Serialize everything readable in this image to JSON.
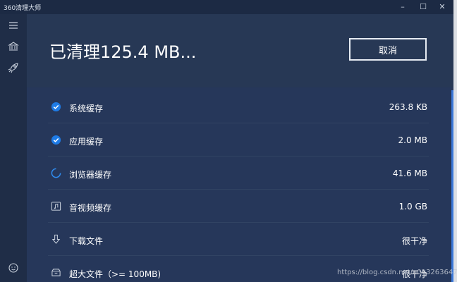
{
  "window": {
    "title": "360清理大师"
  },
  "titlebar": {
    "minimize_glyph": "–",
    "maximize_glyph": "☐",
    "close_glyph": "✕"
  },
  "sidebar": {
    "icons": [
      "menu-icon",
      "bank-icon",
      "rocket-icon",
      "smiley-icon"
    ]
  },
  "header": {
    "status_text": "已清理125.4 MB...",
    "cancel_label": "取消"
  },
  "items": [
    {
      "label": "系统缓存",
      "value": "263.8 KB",
      "icon": "check-circle-icon"
    },
    {
      "label": "应用缓存",
      "value": "2.0 MB",
      "icon": "check-circle-icon"
    },
    {
      "label": "浏览器缓存",
      "value": "41.6 MB",
      "icon": "loading-spinner-icon"
    },
    {
      "label": "音视频缓存",
      "value": "1.0 GB",
      "icon": "music-file-icon"
    },
    {
      "label": "下载文件",
      "value": "很干净",
      "icon": "download-arrow-icon"
    },
    {
      "label": "超大文件（>= 100MB)",
      "value": "很干净",
      "icon": "storage-box-icon"
    }
  ],
  "watermark": "https://blog.csdn.net/u013263647",
  "colors": {
    "accent": "#1e7be6",
    "background": "#23324e",
    "header": "#273855"
  }
}
